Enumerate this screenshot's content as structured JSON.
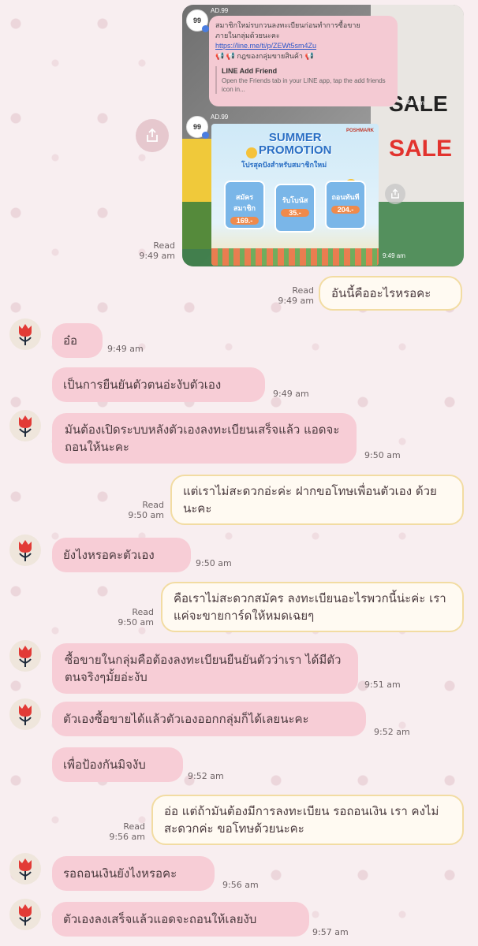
{
  "card": {
    "sender_name": "AD.99",
    "avatar_text": "99",
    "message_line1": "สมาชิกใหม่รบกวนลงทะเบียนก่อนทำการซื้อขาย",
    "message_line2": "ภายในกลุ่มด้วยนะคะ",
    "link": "https://line.me/ti/p/ZEWt5sm4Zu",
    "rules_line": "📢 📢 กฎของกลุ่มขายสินค้า 📢",
    "preview_title": "LINE Add Friend",
    "preview_desc": "Open the Friends tab in your LINE app, tap the add friends icon in...",
    "time1": "9:49 am",
    "time2": "9:49 am",
    "sale_text": "SALE",
    "promo": {
      "title_line1": "SUMMER",
      "title_line2": "PROMOTION",
      "subtitle": "โปรสุดปังสำหรับสมาชิกใหม่",
      "brand": "POSHMARK",
      "tags": [
        {
          "label": "สมัครสมาชิก",
          "value": "169.-"
        },
        {
          "label": "รับโบนัส",
          "value": "35.-"
        },
        {
          "label": "ถอนทันที",
          "value": "204.-"
        }
      ]
    }
  },
  "status": {
    "read": "Read"
  },
  "messages": [
    {
      "text": "อันนี้คืออะไรหรอคะ",
      "time": "9:49 am"
    },
    {
      "text": "อ๋อ",
      "time": "9:49 am"
    },
    {
      "text": "เป็นการยืนยันตัวตนอ่ะงับตัวเอง",
      "time": "9:49 am"
    },
    {
      "text": "มันต้องเปิดระบบหลังตัวเองลงทะเบียนเสร็จแล้ว แอดจะถอนให้นะคะ",
      "time": "9:50 am"
    },
    {
      "text": "แต่เราไม่สะดวกอ่ะค่ะ ฝากขอโทษเพื่อนตัวเอง ด้วยนะคะ",
      "time": "9:50 am"
    },
    {
      "text": "ยังไงหรอคะตัวเอง",
      "time": "9:50 am"
    },
    {
      "text": "คือเราไม่สะดวกสมัคร ลงทะเบียนอะไรพวกนี้น่ะค่ะ เราแค่จะขายการ์ดให้หมดเฉยๆ",
      "time": "9:50 am"
    },
    {
      "text": "ซื้อขายในกลุ่มคือต้องลงทะเบียนยืนยันตัวว่าเรา ได้มีตัวตนจริงๆมั้ยอ่ะงับ",
      "time": "9:51 am"
    },
    {
      "text": "ตัวเองซื้อขายได้แล้วตัวเองออกกลุ่มก็ได้เลยนะคะ",
      "time": "9:52 am"
    },
    {
      "text": "เพื่อป้องกันมิจงับ",
      "time": "9:52 am"
    },
    {
      "text": "อ่อ แต่ถ้ามันต้องมีการลงทะเบียน รอถอนเงิน เรา คงไม่สะดวกค่ะ ขอโทษด้วยนะคะ",
      "time": "9:56 am"
    },
    {
      "text": "รอถอนเงินยังไงหรอคะ",
      "time": "9:56 am"
    },
    {
      "text": "ตัวเองลงเสร็จแล้วแอดจะถอนให้เลยงับ",
      "time": "9:57 am"
    }
  ],
  "icons": {
    "share": "share-icon",
    "flower_avatar": "tulip-icon"
  },
  "colors": {
    "incoming_bubble": "#f7cdd6",
    "outgoing_bubble": "#fffaf2",
    "outgoing_border": "#f2dca2",
    "link": "#2c56c8"
  }
}
